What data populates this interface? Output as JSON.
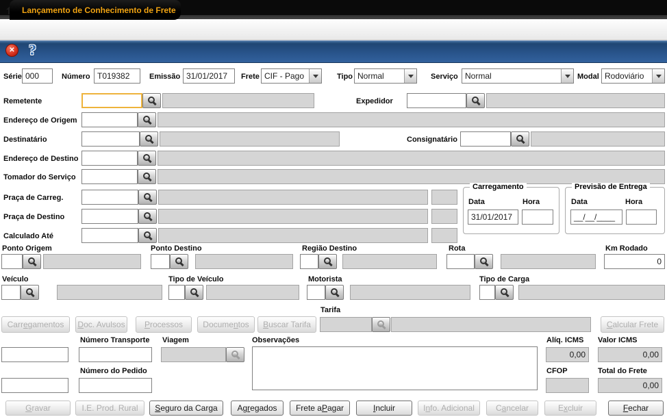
{
  "window": {
    "title": "Lançamento de Conhecimento de Frete"
  },
  "icons": {
    "close_glyph": "✕",
    "help_glyph": "?"
  },
  "top_row": {
    "serie_label": "Série",
    "serie_value": "000",
    "numero_label": "Número",
    "numero_value": "T019382",
    "emissao_label": "Emissão",
    "emissao_value": "31/01/2017",
    "frete_label": "Frete",
    "frete_value": "CIF - Pago",
    "tipo_label": "Tipo",
    "tipo_value": "Normal",
    "servico_label": "Serviço",
    "servico_value": "Normal",
    "modal_label": "Modal",
    "modal_value": "Rodoviário"
  },
  "parties": {
    "remetente_label": "Remetente",
    "expedidor_label": "Expedidor",
    "endereco_origem_label": "Endereço de Origem",
    "destinatario_label": "Destinatário",
    "consignatario_label": "Consignatário",
    "endereco_destino_label": "Endereço de Destino",
    "tomador_label": "Tomador do Serviço",
    "praca_carreg_label": "Praça de Carreg.",
    "praca_destino_label": "Praça de Destino",
    "calculado_ate_label": "Calculado Até"
  },
  "carregamento": {
    "title": "Carregamento",
    "data_label": "Data",
    "hora_label": "Hora",
    "data_value": "31/01/2017",
    "hora_value": ""
  },
  "previsao": {
    "title": "Previsão de Entrega",
    "data_label": "Data",
    "hora_label": "Hora",
    "data_value": "__/__/____",
    "hora_value": ""
  },
  "route": {
    "ponto_origem_label": "Ponto Origem",
    "ponto_destino_label": "Ponto Destino",
    "regiao_destino_label": "Região Destino",
    "rota_label": "Rota",
    "km_rodado_label": "Km Rodado",
    "km_rodado_value": "0"
  },
  "vehicle": {
    "veiculo_label": "Veículo",
    "tipo_veiculo_label": "Tipo de Veículo",
    "motorista_label": "Motorista",
    "tipo_carga_label": "Tipo de Carga"
  },
  "tarifa": {
    "label": "Tarifa",
    "buttons": [
      {
        "label": "Carregamentos",
        "u": 4,
        "enabled": false
      },
      {
        "label": "Doc. Avulsos",
        "u": 0,
        "enabled": false
      },
      {
        "label": "Processos",
        "u": 0,
        "enabled": false
      },
      {
        "label": "Documentos",
        "u": 6,
        "enabled": false
      },
      {
        "label": "Buscar Tarifa",
        "u": 0,
        "enabled": false
      }
    ],
    "calcular_label": "Calcular Frete",
    "calcular_u": 0
  },
  "details": {
    "numero_transporte_label": "Número Transporte",
    "viagem_label": "Viagem",
    "observacoes_label": "Observações",
    "numero_pedido_label": "Número do Pedido",
    "aliq_icms_label": "Alíq. ICMS",
    "aliq_icms_value": "0,00",
    "valor_icms_label": "Valor ICMS",
    "valor_icms_value": "0,00",
    "cfop_label": "CFOP",
    "cfop_value": "",
    "total_frete_label": "Total do Frete",
    "total_frete_value": "0,00"
  },
  "footer": {
    "buttons": [
      {
        "label": "Gravar",
        "u": 0,
        "enabled": false
      },
      {
        "label": "I.E. Prod. Rural",
        "u": -1,
        "enabled": false
      },
      {
        "label": "Seguro da Carga",
        "u": 0,
        "enabled": true
      },
      {
        "label": "Agregados",
        "u": 2,
        "enabled": true
      },
      {
        "label": "Frete a Pagar",
        "u": 8,
        "enabled": true
      },
      {
        "label": "Incluir",
        "u": 0,
        "enabled": true
      },
      {
        "label": "Info. Adicional",
        "u": 1,
        "enabled": false
      },
      {
        "label": "Cancelar",
        "u": 1,
        "enabled": false
      },
      {
        "label": "Excluir",
        "u": 1,
        "enabled": false
      },
      {
        "label": "Fechar",
        "u": 0,
        "enabled": true
      }
    ]
  }
}
